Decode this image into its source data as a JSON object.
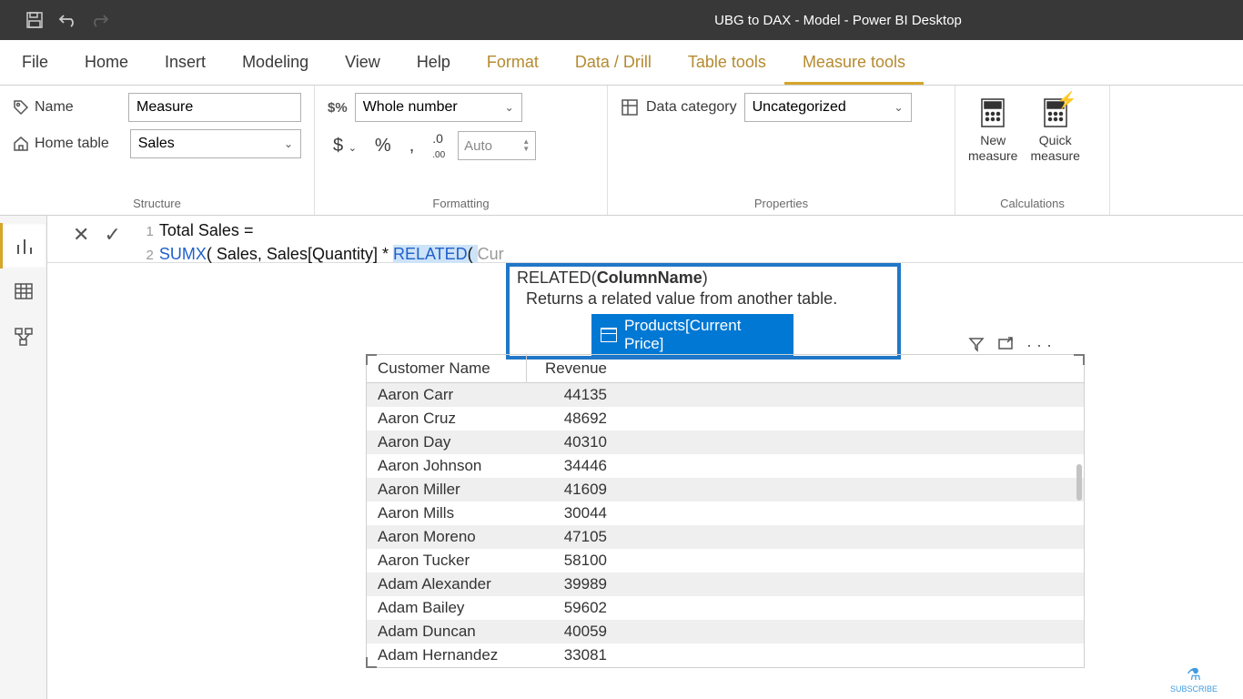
{
  "title": "UBG to DAX - Model - Power BI Desktop",
  "menu": {
    "file": "File",
    "home": "Home",
    "insert": "Insert",
    "modeling": "Modeling",
    "view": "View",
    "help": "Help",
    "format": "Format",
    "datadrill": "Data / Drill",
    "tabletools": "Table tools",
    "measuretools": "Measure tools"
  },
  "structure": {
    "label": "Structure",
    "name_label": "Name",
    "name_value": "Measure",
    "home_label": "Home table",
    "home_value": "Sales"
  },
  "formatting": {
    "label": "Formatting",
    "format_value": "Whole number",
    "auto": "Auto"
  },
  "properties": {
    "label": "Properties",
    "category_label": "Data category",
    "category_value": "Uncategorized"
  },
  "calculations": {
    "label": "Calculations",
    "new": "New\nmeasure",
    "quick": "Quick\nmeasure"
  },
  "formula": {
    "line1_name": "Total Sales",
    "line1_eq": " = ",
    "line2_func": "SUMX",
    "line2_args": "( Sales, Sales[Quantity] * ",
    "line2_related": "RELATED",
    "line2_paren": "( ",
    "line2_typed": "Cur"
  },
  "intellisense": {
    "fn": "RELATED",
    "param": "ColumnName",
    "desc": "Returns a related value from another table.",
    "suggestion": "Products[Current Price]"
  },
  "table": {
    "headers": [
      "Customer Name",
      "Revenue"
    ],
    "rows": [
      [
        "Aaron Carr",
        "44135"
      ],
      [
        "Aaron Cruz",
        "48692"
      ],
      [
        "Aaron Day",
        "40310"
      ],
      [
        "Aaron Johnson",
        "34446"
      ],
      [
        "Aaron Miller",
        "41609"
      ],
      [
        "Aaron Mills",
        "30044"
      ],
      [
        "Aaron Moreno",
        "47105"
      ],
      [
        "Aaron Tucker",
        "58100"
      ],
      [
        "Adam Alexander",
        "39989"
      ],
      [
        "Adam Bailey",
        "59602"
      ],
      [
        "Adam Duncan",
        "40059"
      ],
      [
        "Adam Hernandez",
        "33081"
      ]
    ]
  },
  "watermark": "SUBSCRIBE"
}
